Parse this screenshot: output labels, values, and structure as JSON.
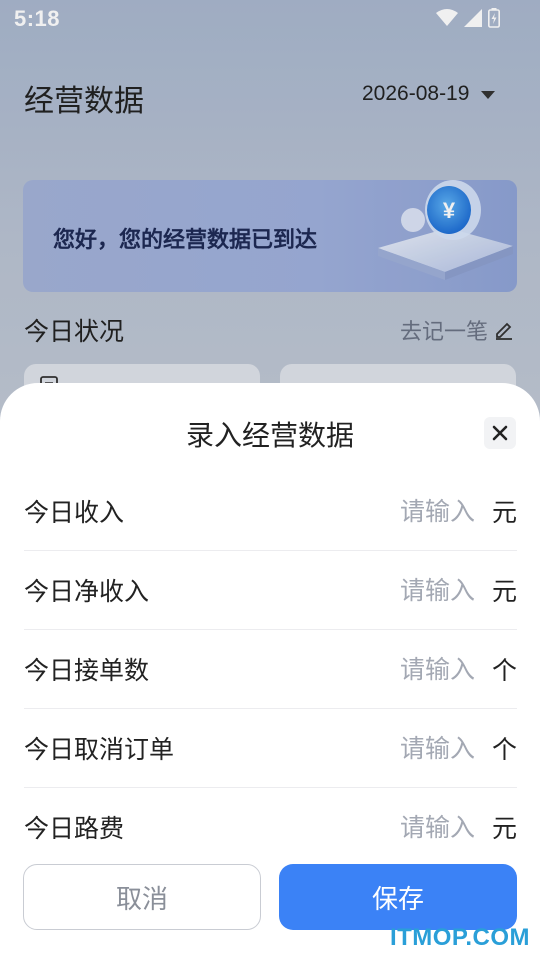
{
  "status_bar": {
    "time": "5:18"
  },
  "header": {
    "title": "经营数据",
    "date": "2026-08-19"
  },
  "banner": {
    "text": "您好，您的经营数据已到达"
  },
  "today": {
    "title": "今日状况",
    "record_link": "去记一笔"
  },
  "sheet": {
    "title": "录入经营数据",
    "rows": [
      {
        "label": "今日收入",
        "placeholder": "请输入",
        "unit": "元"
      },
      {
        "label": "今日净收入",
        "placeholder": "请输入",
        "unit": "元"
      },
      {
        "label": "今日接单数",
        "placeholder": "请输入",
        "unit": "个"
      },
      {
        "label": "今日取消订单",
        "placeholder": "请输入",
        "unit": "个"
      },
      {
        "label": "今日路费",
        "placeholder": "请输入",
        "unit": "元"
      }
    ],
    "cancel_label": "取消",
    "save_label": "保存"
  },
  "watermark": "ITMOP.COM",
  "colors": {
    "primary": "#3b82f6",
    "watermark": "#2a9fd8"
  }
}
